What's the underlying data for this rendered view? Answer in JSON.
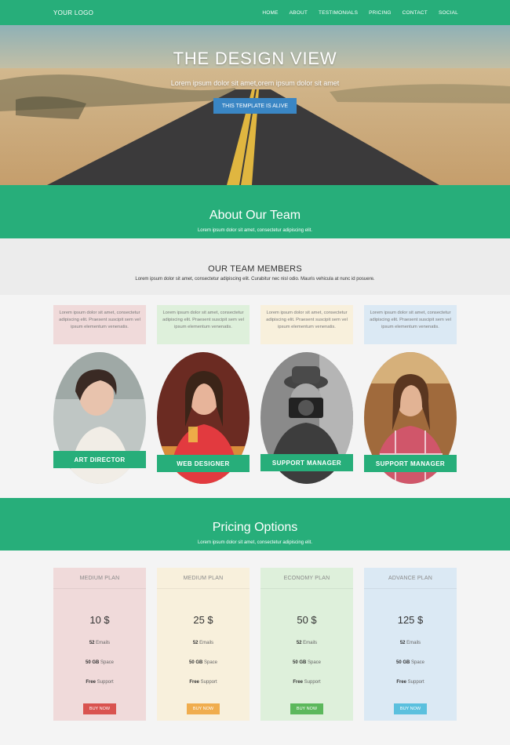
{
  "nav": {
    "logo": "YOUR LOGO",
    "items": [
      "HOME",
      "ABOUT",
      "TESTIMONIALS",
      "PRICING",
      "CONTACT",
      "SOCIAL"
    ]
  },
  "hero": {
    "title": "THE DESIGN VIEW",
    "subtitle": "Lorem ipsum dolor sit amet,orem ipsum dolor sit amet",
    "button": "THIS TEMPLATE IS ALIVE"
  },
  "about": {
    "title": "About Our Team",
    "subtitle": "Lorem ipsum dolor sit amet, consectetur adipiscing elit."
  },
  "members": {
    "title": "OUR TEAM MEMBERS",
    "text": "Lorem ipsum dolor sit amet, consectetur adipiscing elit. Curabitur nec nisl odio. Mauris vehicula at nunc id posuere."
  },
  "team": [
    {
      "text": "Lorem ipsum dolor sit amet, consectetur adipiscing elit. Praesent suscipit sem vel ipsum elementum venenatis.",
      "role": "ART DIRECTOR"
    },
    {
      "text": "Lorem ipsum dolor sit amet, consectetur adipiscing elit. Praesent suscipit sem vel ipsum elementum venenatis.",
      "role": "WEB DESIGNER"
    },
    {
      "text": "Lorem ipsum dolor sit amet, consectetur adipiscing elit. Praesent suscipit sem vel ipsum elementum venenatis.",
      "role": "SUPPORT MANAGER"
    },
    {
      "text": "Lorem ipsum dolor sit amet, consectetur adipiscing elit. Praesent suscipit sem vel ipsum elementum venenatis.",
      "role": "SUPPORT MANAGER"
    }
  ],
  "pricing": {
    "title": "Pricing Options",
    "subtitle": "Lorem ipsum dolor sit amet, consectetur adipiscing elit.",
    "plans": [
      {
        "name": "MEDIUM PLAN",
        "price": "10 $",
        "f1b": "52",
        "f1": " Emails",
        "f2b": "50 GB",
        "f2": " Space",
        "f3b": "Free",
        "f3": " Support",
        "button": "BUY NOW",
        "btn_color": "#d9534f"
      },
      {
        "name": "MEDIUM PLAN",
        "price": "25 $",
        "f1b": "52",
        "f1": " Emails",
        "f2b": "50 GB",
        "f2": " Space",
        "f3b": "Free",
        "f3": " Support",
        "button": "BUY NOW",
        "btn_color": "#f0ad4e"
      },
      {
        "name": "ECONOMY PLAN",
        "price": "50 $",
        "f1b": "52",
        "f1": " Emails",
        "f2b": "50 GB",
        "f2": " Space",
        "f3b": "Free",
        "f3": " Support",
        "button": "BUY NOW",
        "btn_color": "#5cb85c"
      },
      {
        "name": "ADVANCE PLAN",
        "price": "125 $",
        "f1b": "52",
        "f1": " Emails",
        "f2b": "50 GB",
        "f2": " Space",
        "f3b": "Free",
        "f3": " Support",
        "button": "BUY NOW",
        "btn_color": "#5bc0de"
      }
    ]
  },
  "colors": {
    "accent": "#27ae7a",
    "hero_button": "#3a86c4"
  }
}
